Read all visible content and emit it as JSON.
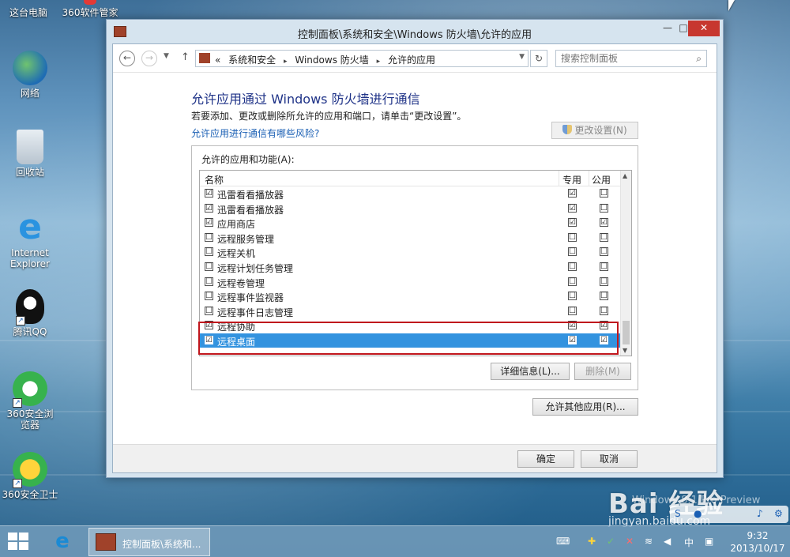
{
  "desktop": {
    "icons": [
      {
        "label": "这台电脑"
      },
      {
        "label": "360软件管家"
      },
      {
        "label": "网络"
      },
      {
        "label": "回收站"
      },
      {
        "label": "Internet Explorer"
      },
      {
        "label": "腾讯QQ"
      },
      {
        "label": "360安全浏览器"
      },
      {
        "label": "360安全卫士"
      }
    ]
  },
  "window": {
    "title": "控制面板\\系统和安全\\Windows 防火墙\\允许的应用",
    "controls": {
      "minimize": "—",
      "maximize": "□",
      "close": "✕"
    },
    "address": {
      "prefix": "«",
      "crumbs": [
        "系统和安全",
        "Windows 防火墙",
        "允许的应用"
      ],
      "separator": "▸"
    },
    "search_placeholder": "搜索控制面板",
    "heading": "允许应用通过 Windows 防火墙进行通信",
    "subtext": "若要添加、更改或删除所允许的应用和端口，请单击“更改设置”。",
    "risk_link": "允许应用进行通信有哪些风险?",
    "change_settings": "更改设置(N)",
    "group_label": "允许的应用和功能(A):",
    "columns": {
      "name": "名称",
      "private": "专用",
      "public": "公用"
    },
    "rows": [
      {
        "name": "迅雷看看播放器",
        "enabled": "☑",
        "private": "☑",
        "public": "☐"
      },
      {
        "name": "迅雷看看播放器",
        "enabled": "☑",
        "private": "☑",
        "public": "☐"
      },
      {
        "name": "应用商店",
        "enabled": "☑",
        "private": "☑",
        "public": "☑"
      },
      {
        "name": "远程服务管理",
        "enabled": "☐",
        "private": "☐",
        "public": "☐"
      },
      {
        "name": "远程关机",
        "enabled": "☐",
        "private": "☐",
        "public": "☐"
      },
      {
        "name": "远程计划任务管理",
        "enabled": "☐",
        "private": "☐",
        "public": "☐"
      },
      {
        "name": "远程卷管理",
        "enabled": "☐",
        "private": "☐",
        "public": "☐"
      },
      {
        "name": "远程事件监视器",
        "enabled": "☐",
        "private": "☐",
        "public": "☐"
      },
      {
        "name": "远程事件日志管理",
        "enabled": "☐",
        "private": "☐",
        "public": "☐"
      },
      {
        "name": "远程协助",
        "enabled": "☑",
        "private": "☑",
        "public": "☑"
      },
      {
        "name": "远程桌面",
        "enabled": "☑",
        "private": "☑",
        "public": "☑"
      }
    ],
    "details_button": "详细信息(L)...",
    "delete_button": "删除(M)",
    "allow_other_button": "允许其他应用(R)...",
    "ok_button": "确定",
    "cancel_button": "取消"
  },
  "taskbar": {
    "task_label": "控制面板\\系统和...",
    "tray_lang": "中",
    "time": "9:32",
    "date": "2013/10/17"
  },
  "watermark": {
    "brand": "Bai 经验",
    "site": "jingyan.baidu.com",
    "preview": "Windows 8.1 Pro Preview"
  }
}
